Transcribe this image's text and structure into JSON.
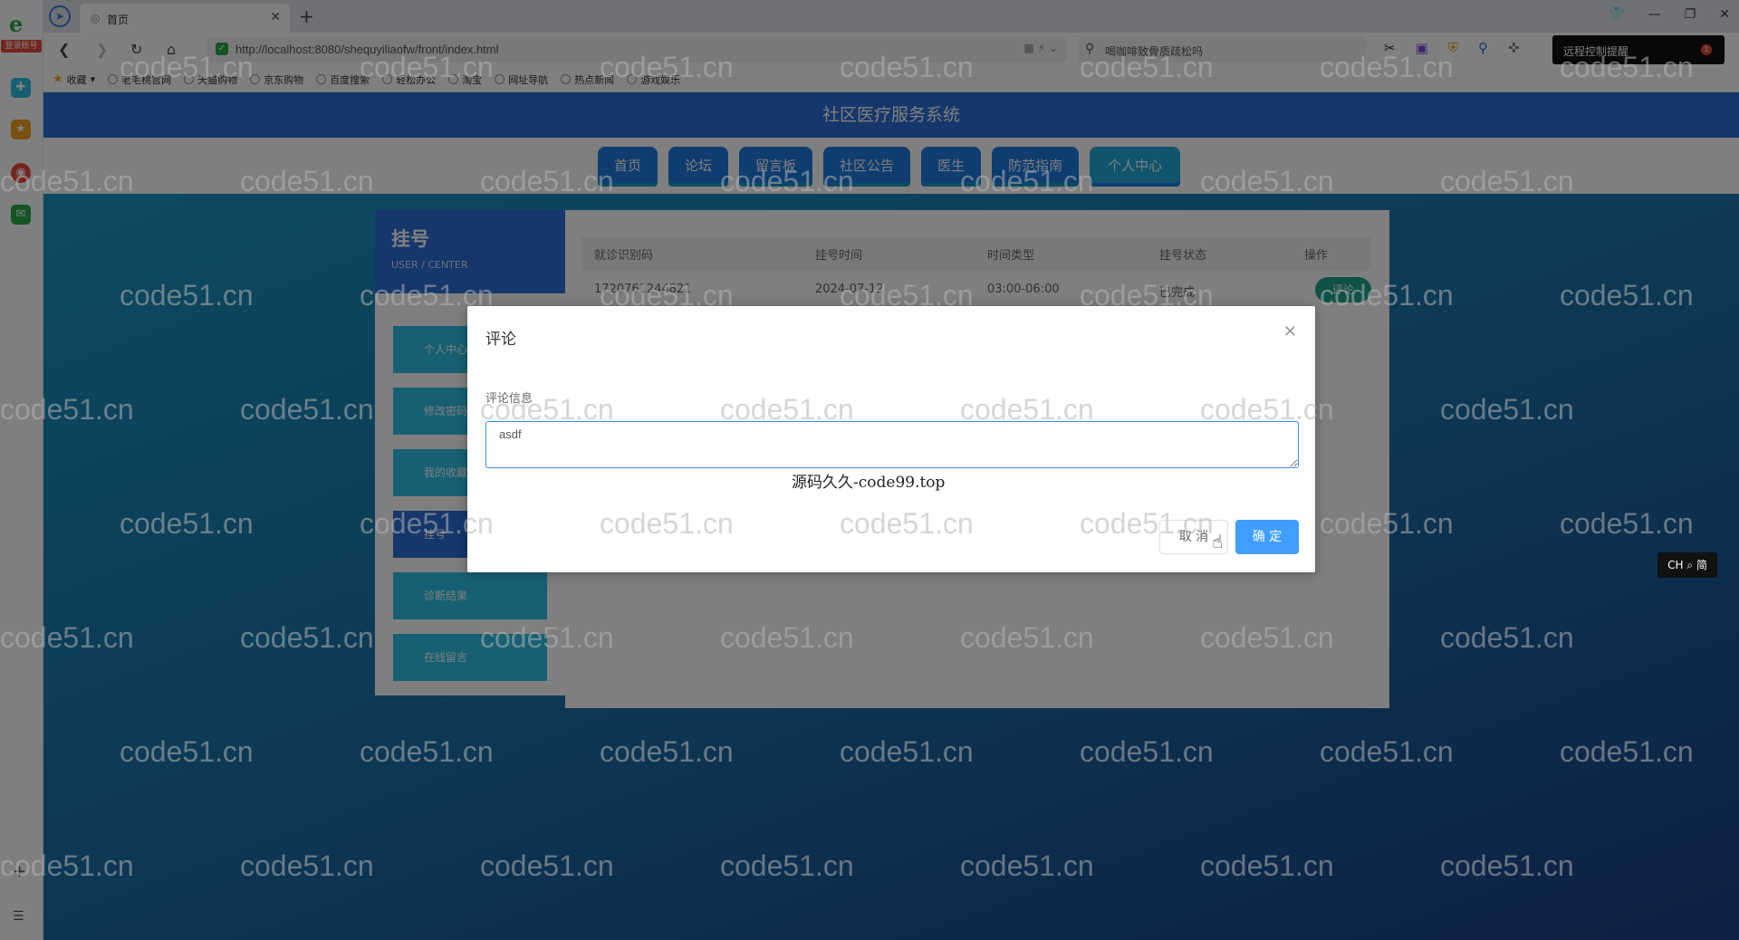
{
  "browser": {
    "rail_badge": "登录账号",
    "tab_title": "首页",
    "url": "http://localhost:8080/shequyiliaofw/front/index.html",
    "search_text": "喝咖啡致骨质疏松吗",
    "remote_label": "远程控制提醒",
    "remote_count": "1",
    "bookmarks": [
      "收藏",
      "老毛桃官网",
      "天猫购物",
      "京东购物",
      "百度搜索",
      "轻松办公",
      "淘宝",
      "网址导航",
      "热点新闻",
      "游戏娱乐"
    ]
  },
  "site": {
    "title": "社区医疗服务系统",
    "menu": [
      "首页",
      "论坛",
      "留言板",
      "社区公告",
      "医生",
      "防范指南",
      "个人中心"
    ]
  },
  "side": {
    "title": "挂号",
    "subtitle": "USER / CENTER",
    "items": [
      "个人中心",
      "修改密码",
      "我的收藏",
      "挂号",
      "诊断结果",
      "在线留言"
    ]
  },
  "table": {
    "headers": [
      "就诊识别码",
      "挂号时间",
      "时间类型",
      "挂号状态",
      "操作"
    ],
    "row": [
      "1720761244821",
      "2024-07-12",
      "03:00-06:00",
      "已完成"
    ],
    "action": "评论"
  },
  "modal": {
    "title": "评论",
    "field_label": "评论信息",
    "comment_value": "asdf",
    "cancel": "取 消",
    "confirm": "确 定"
  },
  "watermark_center": "源码久久-code99.top",
  "watermark_text": "code51.cn",
  "ime": "CH ⌕ 简"
}
